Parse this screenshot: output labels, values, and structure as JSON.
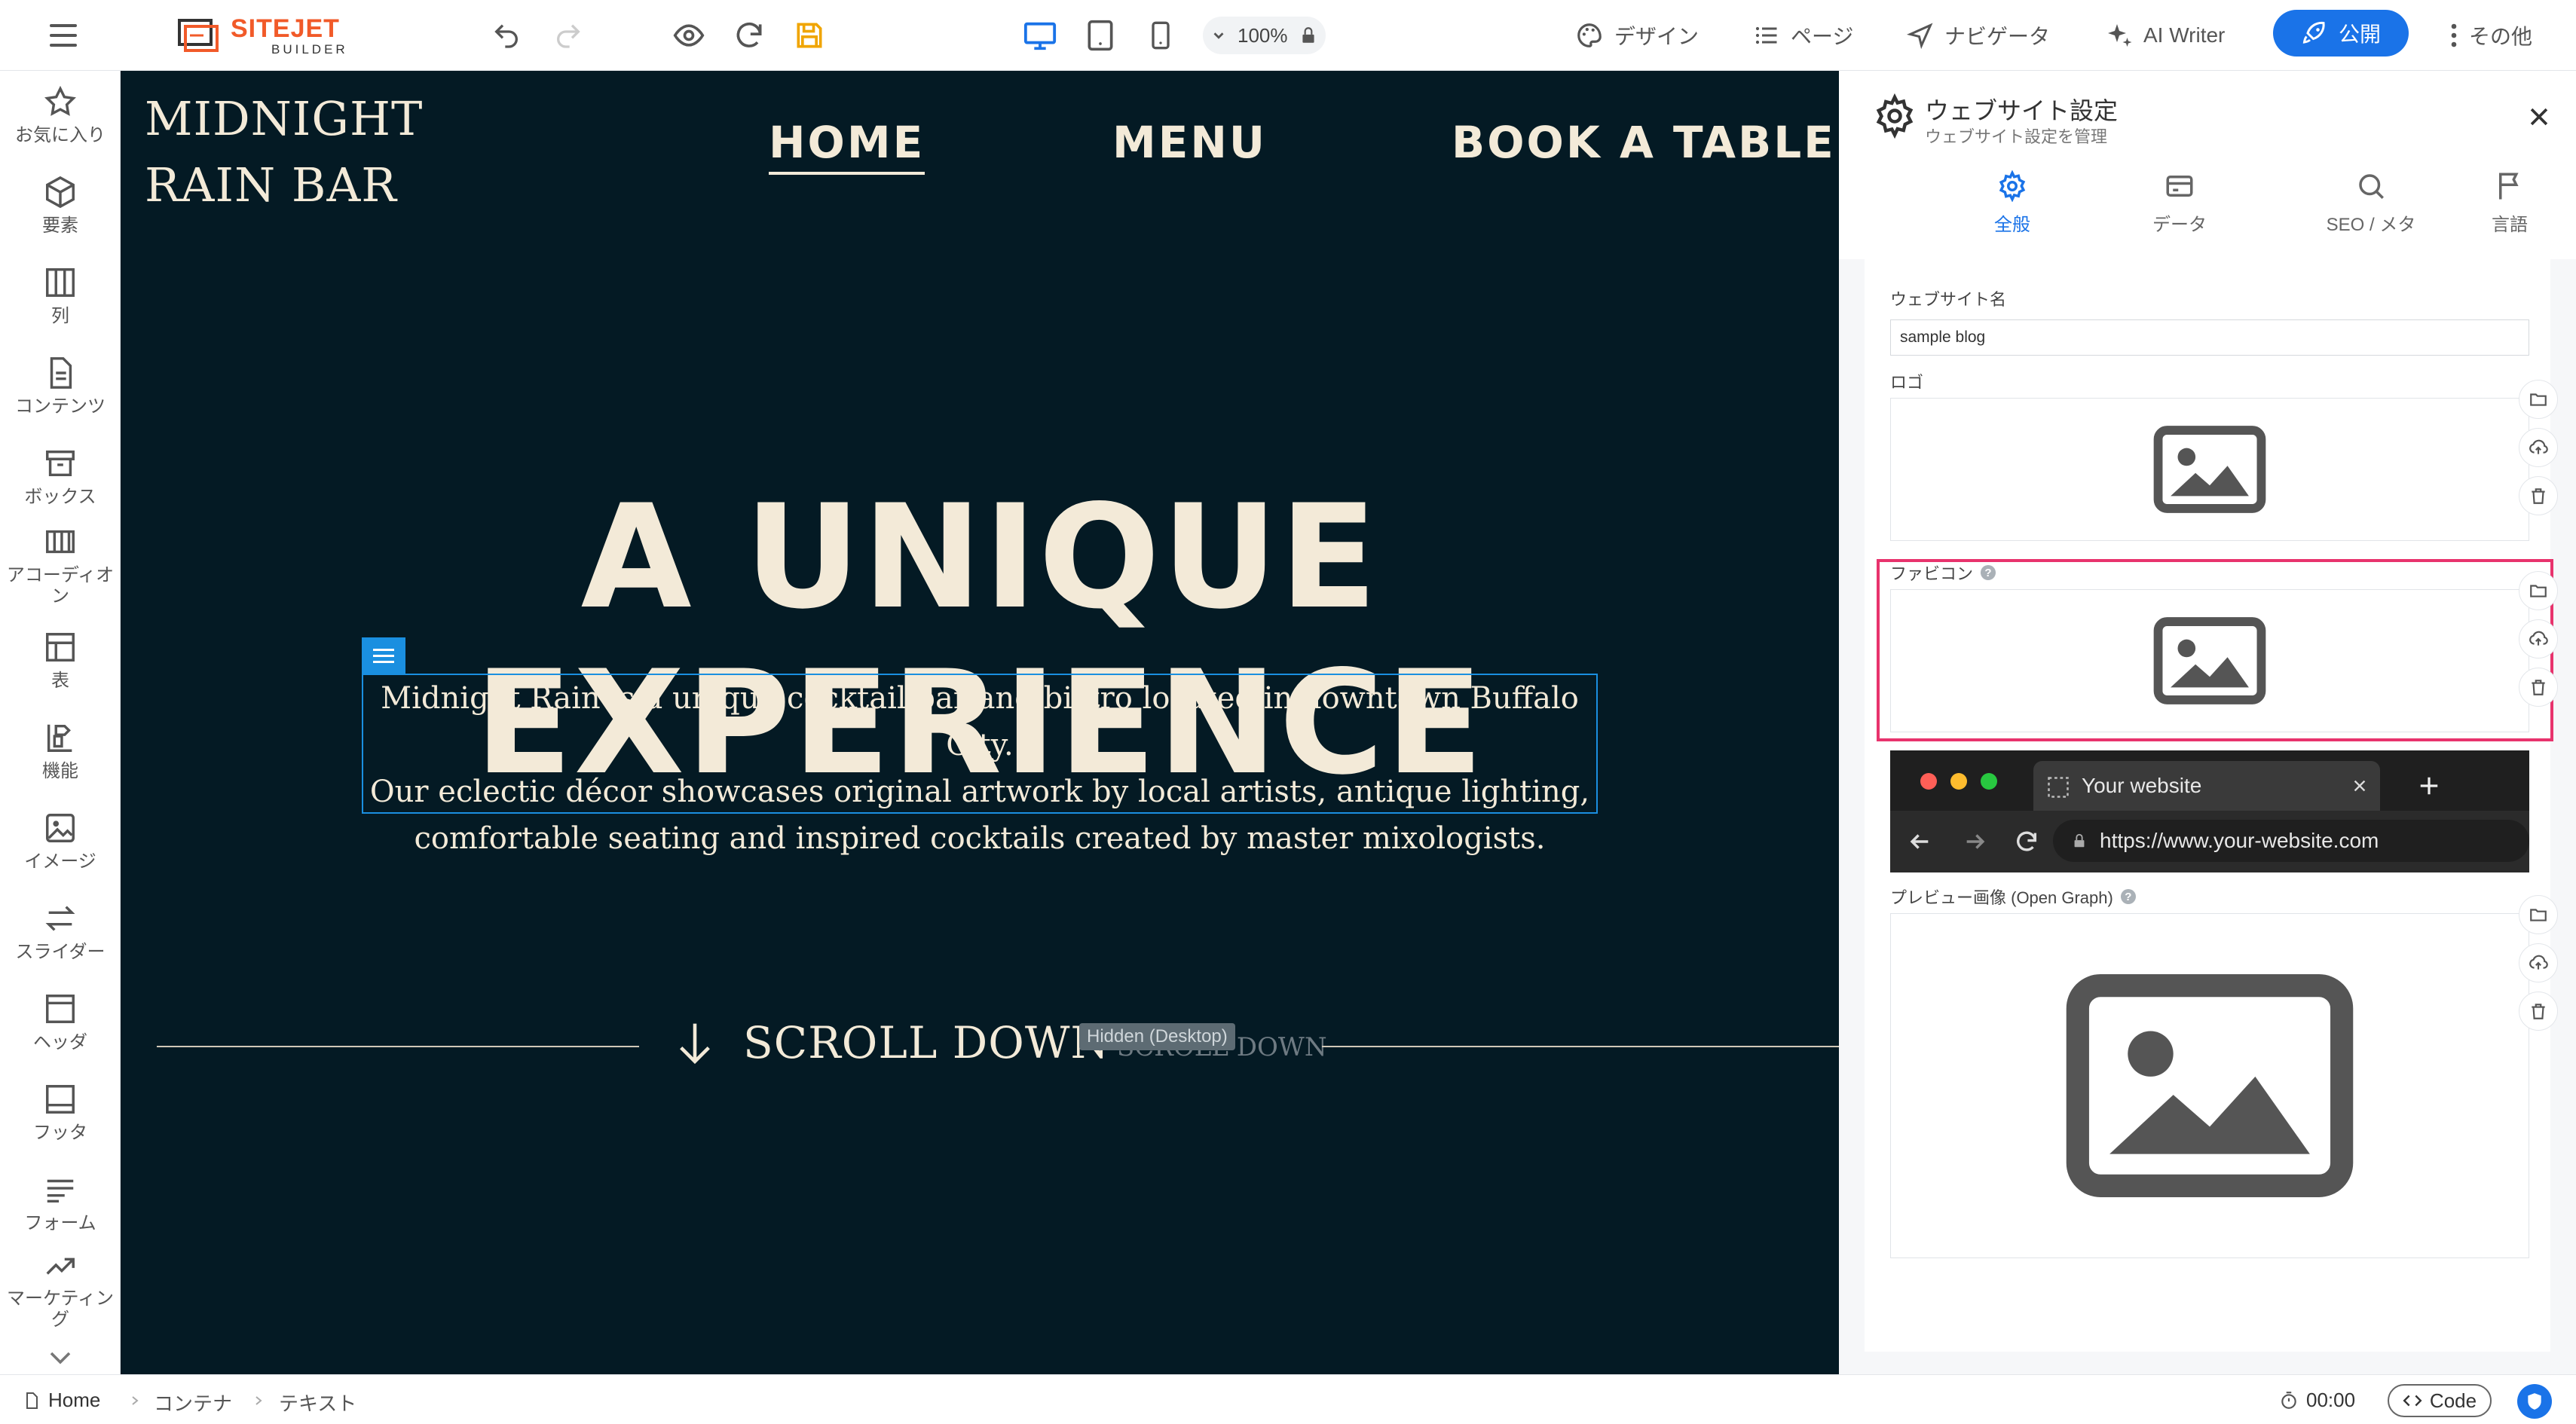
{
  "topbar": {
    "logo_line1": "SITEJET",
    "logo_line2": "BUILDER",
    "zoom": "100%",
    "nav": {
      "design": "デザイン",
      "page": "ページ",
      "navigator": "ナビゲータ",
      "ai_writer": "AI Writer",
      "publish": "公開",
      "more": "その他"
    }
  },
  "sidebar": {
    "items": [
      {
        "label": "お気に入り",
        "icon": "star-icon"
      },
      {
        "label": "要素",
        "icon": "cube-icon"
      },
      {
        "label": "列",
        "icon": "columns-icon"
      },
      {
        "label": "コンテンツ",
        "icon": "document-icon"
      },
      {
        "label": "ボックス",
        "icon": "box-icon"
      },
      {
        "label": "アコーディオン",
        "icon": "accordion-icon"
      },
      {
        "label": "表",
        "icon": "table-icon"
      },
      {
        "label": "機能",
        "icon": "feature-icon"
      },
      {
        "label": "イメージ",
        "icon": "image-icon"
      },
      {
        "label": "スライダー",
        "icon": "slider-icon"
      },
      {
        "label": "ヘッダ",
        "icon": "header-icon"
      },
      {
        "label": "フッタ",
        "icon": "footer-icon"
      },
      {
        "label": "フォーム",
        "icon": "form-icon"
      },
      {
        "label": "マーケティング",
        "icon": "chart-icon"
      }
    ]
  },
  "canvas": {
    "site_logo_line1": "MIDNIGHT",
    "site_logo_line2": "RAIN BAR",
    "nav": [
      "HOME",
      "MENU",
      "BOOK A TABLE"
    ],
    "hero_title": "A UNIQUE EXPERIENCE",
    "description": [
      "Midnight Rain is a unique cocktail bar and bistro located in downtown Buffalo City.",
      "Our eclectic décor showcases original artwork by local artists, antique lighting,",
      "comfortable seating and inspired cocktails created by master mixologists."
    ],
    "scroll_text": "SCROLL DOWN",
    "hidden_tag": "Hidden (Desktop)",
    "ghost_text": "SCROLL DOWN"
  },
  "panel": {
    "title": "ウェブサイト設定",
    "subtitle": "ウェブサイト設定を管理",
    "tabs": [
      "全般",
      "データ",
      "SEO / メタ",
      "言語"
    ],
    "site_name_label": "ウェブサイト名",
    "site_name_value": "sample blog",
    "logo_label": "ロゴ",
    "favicon_label": "ファビコン",
    "browser_tab_title": "Your website",
    "browser_url": "https://www.your-website.com",
    "og_label": "プレビュー画像 (Open Graph)"
  },
  "statusbar": {
    "crumbs": [
      "Home",
      "コンテナ",
      "テキスト"
    ],
    "timer": "00:00",
    "code_label": "Code"
  },
  "colors": {
    "accent": "#1a73e8",
    "brand": "#f15a29",
    "canvas_bg": "#041a24",
    "site_text": "#f3ead8",
    "highlight": "#e8336d"
  }
}
